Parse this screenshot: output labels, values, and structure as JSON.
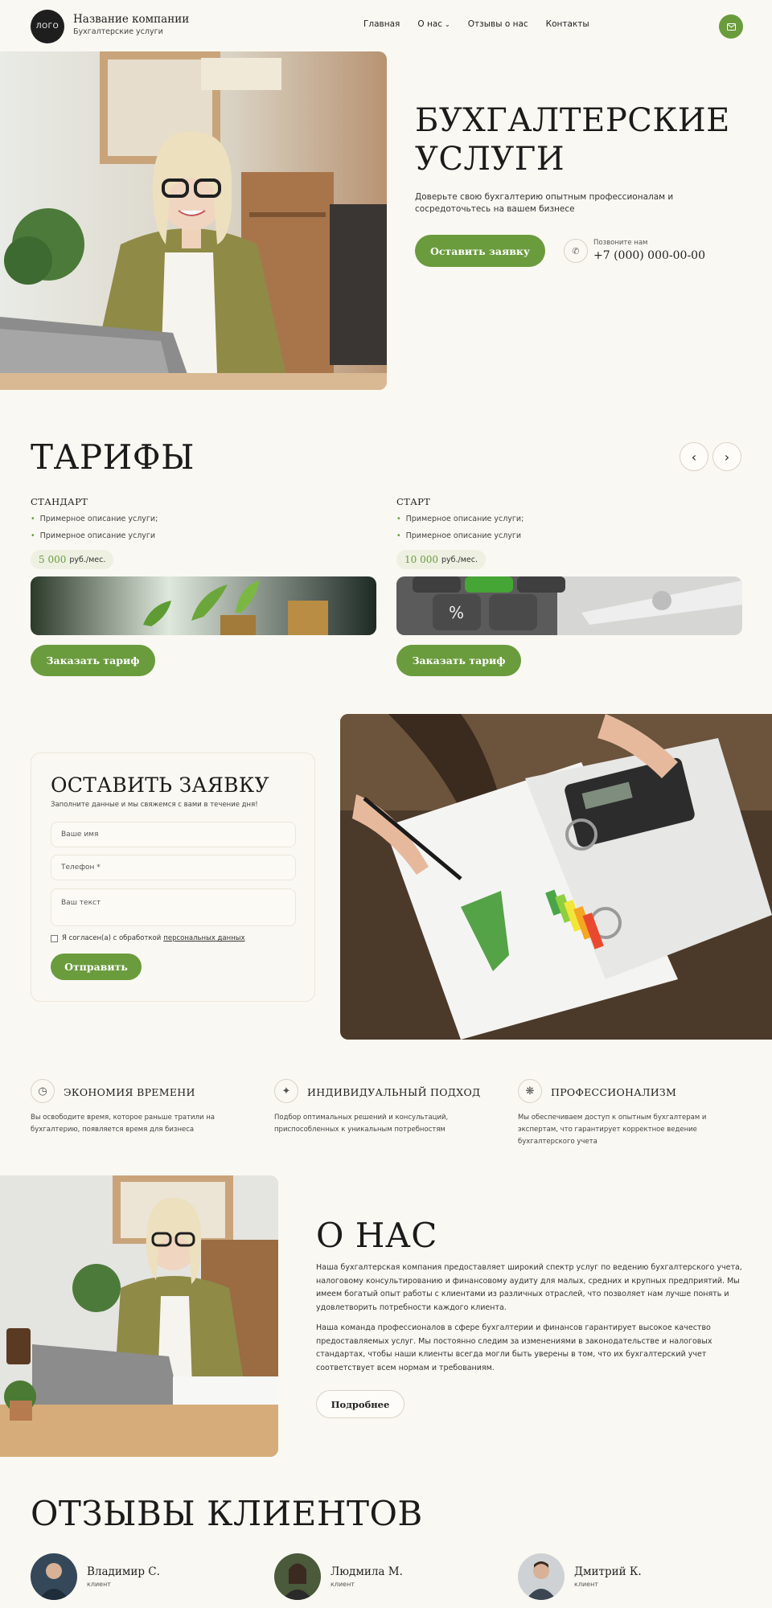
{
  "header": {
    "logo_text": "ЛОГО",
    "company_name": "Название компании",
    "company_sub": "Бухгалтерские услуги",
    "nav": [
      "Главная",
      "О нас",
      "Отзывы о нас",
      "Контакты"
    ],
    "mail_icon": "mail-icon"
  },
  "hero": {
    "title_line1": "БУХГАЛТЕРСКИЕ",
    "title_line2": "УСЛУГИ",
    "text": "Доверьте свою бухгалтерию опытным профессионалам и сосредоточьтесь на вашем бизнесе",
    "cta": "Оставить заявку",
    "phone_label": "Позвоните нам",
    "phone": "+7 (000) 000-00-00"
  },
  "tariffs": {
    "title": "ТАРИФЫ",
    "items": [
      {
        "name": "СТАНДАРТ",
        "lines": [
          "Примерное описание услуги;",
          "Примерное описание услуги"
        ],
        "price": "5 000",
        "unit": "руб./мес.",
        "button": "Заказать тариф"
      },
      {
        "name": "СТАРТ",
        "lines": [
          "Примерное описание услуги;",
          "Примерное описание услуги"
        ],
        "price": "10 000",
        "unit": "руб./мес.",
        "button": "Заказать тариф"
      }
    ]
  },
  "form": {
    "title": "ОСТАВИТЬ ЗАЯВКУ",
    "subtitle": "Заполните данные и мы свяжемся с вами в течение дня!",
    "name_placeholder": "Ваше имя",
    "phone_placeholder": "Телефон *",
    "text_placeholder": "Ваш текст",
    "agree": "Я согласен(а) с обработкой",
    "agree_link": "персональных данных",
    "submit": "Отправить"
  },
  "features": [
    {
      "title": "ЭКОНОМИЯ ВРЕМЕНИ",
      "text": "Вы освободите время, которое раньше тратили на бухгалтерию, появляется время для бизнеса",
      "icon": "clock-icon"
    },
    {
      "title": "ИНДИВИДУАЛЬНЫЙ ПОДХОД",
      "text": "Подбор оптимальных решений и консультаций, приспособленных к уникальным потребностям",
      "icon": "handshake-icon"
    },
    {
      "title": "ПРОФЕССИОНАЛИЗМ",
      "text": "Мы обеспечиваем доступ к опытным бухгалтерам и экспертам, что гарантирует корректное ведение бухгалтерского учета",
      "icon": "team-icon"
    }
  ],
  "about": {
    "title": "О НАС",
    "p1": "Наша бухгалтерская компания предоставляет широкий спектр услуг по ведению бухгалтерского учета, налоговому консультированию и финансовому аудиту для малых, средних и крупных предприятий. Мы имеем богатый опыт работы с клиентами из различных отраслей, что позволяет нам лучше понять и удовлетворить потребности каждого клиента.",
    "p2": "Наша команда профессионалов в сфере бухгалтерии и финансов гарантирует высокое качество предоставляемых услуг. Мы постоянно следим за изменениями в законодательстве и налоговых стандартах, чтобы наши клиенты всегда могли быть уверены в том, что их бухгалтерский учет соответствует всем нормам и требованиям.",
    "button": "Подробнее"
  },
  "reviews": {
    "title": "ОТЗЫВЫ КЛИЕНТОВ",
    "items": [
      {
        "name": "Владимир С.",
        "role": "клиент"
      },
      {
        "name": "Людмила М.",
        "role": "клиент"
      },
      {
        "name": "Дмитрий К.",
        "role": "клиент"
      }
    ]
  },
  "colors": {
    "accent": "#6a9b3d",
    "background": "#faf8f2",
    "dark": "#1e1e1e"
  }
}
